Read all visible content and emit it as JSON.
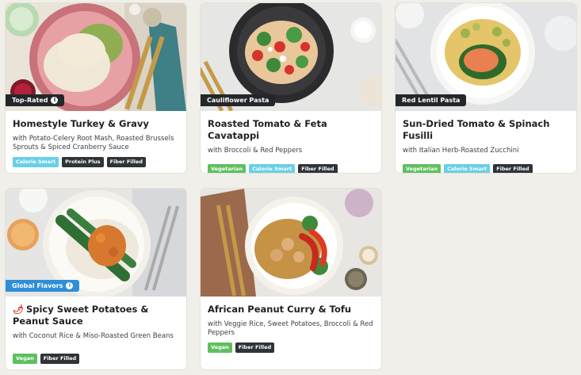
{
  "cards": [
    {
      "overlay": "Top-Rated",
      "title": "Homestyle Turkey & Gravy",
      "subtitle": "with Potato-Celery Root Mash, Roasted Brussels Sprouts & Spiced Cranberry Sauce",
      "tags": [
        "Calorie Smart",
        "Protein Plus",
        "Fiber Filled"
      ]
    },
    {
      "overlay": "Cauliflower Pasta",
      "title": "Roasted Tomato & Feta Cavatappi",
      "subtitle": "with Broccoli & Red Peppers",
      "tags": [
        "Vegetarian",
        "Calorie Smart",
        "Fiber Filled"
      ]
    },
    {
      "overlay": "Red Lentil Pasta",
      "title": "Sun-Dried Tomato & Spinach Fusilli",
      "subtitle": "with Italian Herb-Roasted Zucchini",
      "tags": [
        "Vegetarian",
        "Calorie Smart",
        "Fiber Filled"
      ]
    },
    {
      "overlay": "Global Flavors",
      "title": "Spicy Sweet Potatoes & Peanut Sauce",
      "subtitle": "with Coconut Rice & Miso-Roasted Green Beans",
      "tags": [
        "Vegan",
        "Fiber Filled"
      ]
    },
    {
      "title": "African Peanut Curry & Tofu",
      "subtitle": "with Veggie Rice, Sweet Potatoes, Broccoli & Red Peppers",
      "tags": [
        "Vegan",
        "Fiber Filled"
      ]
    }
  ],
  "icons": {
    "info": "i",
    "spicy": "chili-pepper-icon"
  },
  "colors": {
    "vegan_vegetarian": "#5fbf5f",
    "calorie_smart": "#69cfe8",
    "dark_tag": "#2f3439",
    "global_flavors": "#2e8fd8"
  }
}
